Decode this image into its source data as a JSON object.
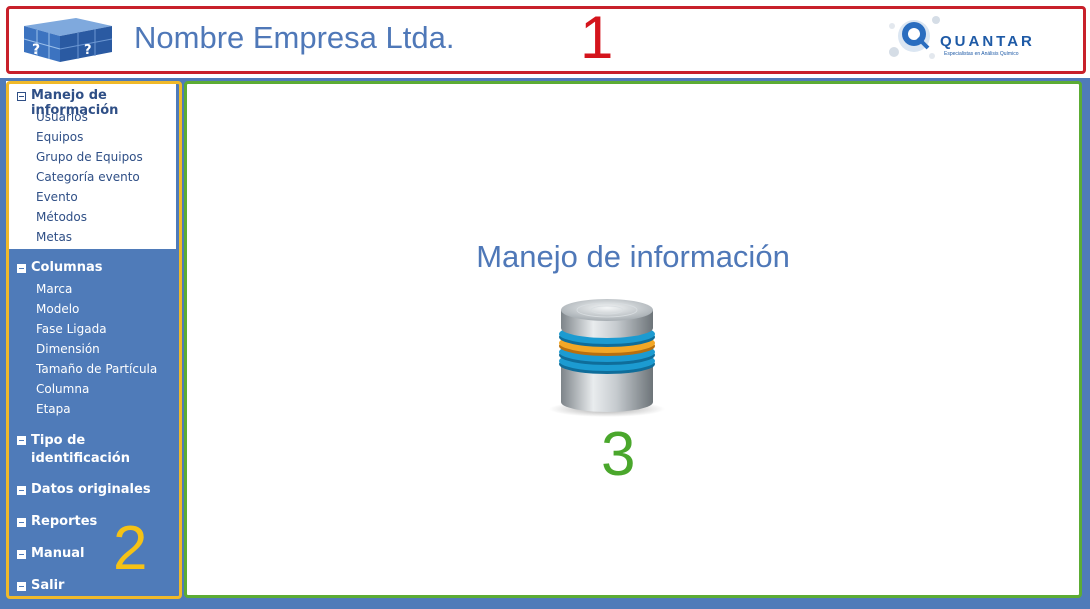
{
  "header": {
    "company_name": "Nombre Empresa Ltda.",
    "marker": "1",
    "partner_logo_word": "QUANTAR",
    "partner_logo_tagline": "Especialistas en Análisis Químico",
    "frame_color": "#c8202a"
  },
  "sidebar": {
    "marker": "2",
    "frame_color": "#f0b929",
    "groups": [
      {
        "label": "Manejo de información",
        "expanded": true,
        "items": [
          "Usuarios",
          "Equipos",
          "Grupo de Equipos",
          "Categoría evento",
          "Evento",
          "Métodos",
          "Metas"
        ]
      },
      {
        "label": "Columnas",
        "expanded": true,
        "items": [
          "Marca",
          "Modelo",
          "Fase Ligada",
          "Dimensión",
          "Tamaño de Partícula",
          "Columna",
          "Etapa"
        ]
      },
      {
        "label_line1": "Tipo de",
        "label_line2": "identificación",
        "expanded": false
      },
      {
        "label": "Datos originales",
        "expanded": false
      },
      {
        "label": "Reportes",
        "expanded": false
      },
      {
        "label": "Manual",
        "expanded": false
      },
      {
        "label": "Salir",
        "expanded": false
      }
    ]
  },
  "main": {
    "title": "Manejo de información",
    "icon": "database-icon",
    "marker": "3",
    "frame_color": "#5cac34"
  },
  "colors": {
    "background": "#4f7bb9",
    "accent_text": "#4f78b8"
  }
}
